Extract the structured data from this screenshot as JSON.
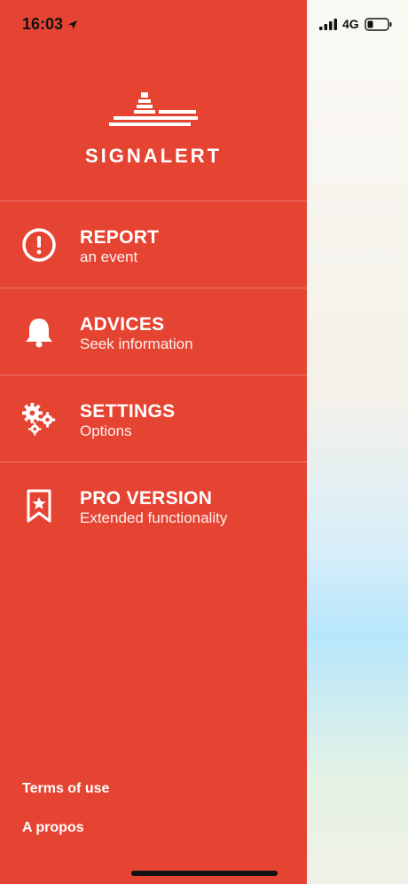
{
  "status_bar": {
    "time": "16:03",
    "network": "4G",
    "location_icon": "location-arrow-icon",
    "signal_icon": "signal-bars-icon",
    "battery_icon": "battery-icon"
  },
  "drawer": {
    "brand": "SIGNALERT",
    "logo_icon": "lighthouse-logo-icon",
    "accent_color": "#e64433",
    "menu": [
      {
        "title": "REPORT",
        "subtitle": "an event",
        "icon": "alert-circle-icon"
      },
      {
        "title": "ADVICES",
        "subtitle": "Seek information",
        "icon": "bell-icon"
      },
      {
        "title": "SETTINGS",
        "subtitle": "Options",
        "icon": "gears-icon"
      },
      {
        "title": "PRO VERSION",
        "subtitle": "Extended functionality",
        "icon": "bookmark-star-icon"
      }
    ],
    "footer_links": [
      "Terms of use",
      "A propos"
    ]
  }
}
